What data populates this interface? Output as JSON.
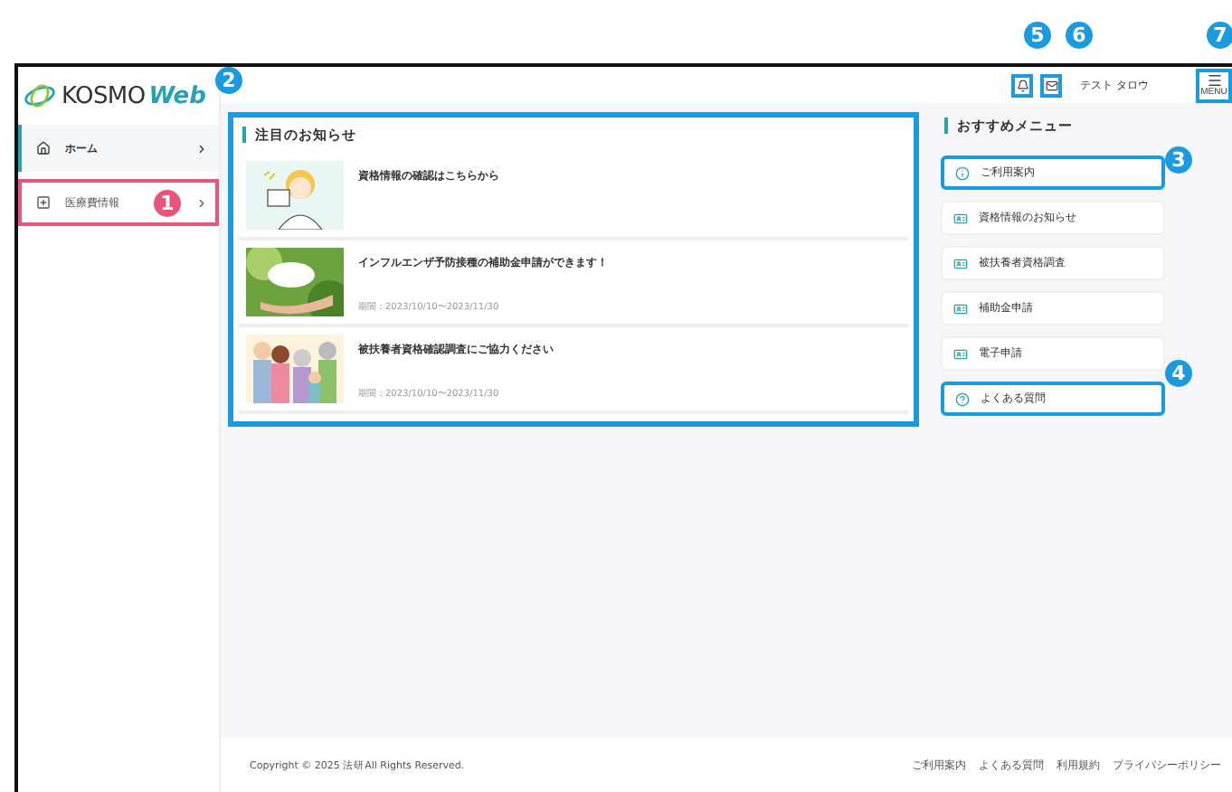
{
  "logo": {
    "brand": "KOSMO",
    "suffix": "Web"
  },
  "header": {
    "user_name": "テスト タロウ",
    "menu_label": "MENU",
    "bell_highlighted": true,
    "mail_highlighted": true,
    "menu_highlighted": true
  },
  "sidebar": {
    "items": [
      {
        "label": "ホーム",
        "kind": "home",
        "selected": true,
        "highlighted": false
      },
      {
        "label": "医療費情報",
        "kind": "plus",
        "selected": false,
        "highlighted": true
      }
    ]
  },
  "notices": {
    "title": "注目のお知らせ",
    "highlighted": true,
    "items": [
      {
        "title": "資格情報の確認はこちらから"
      },
      {
        "title": "インフルエンザ予防接種の補助金申請ができます！",
        "period": "期間：2023/10/10〜2023/11/30"
      },
      {
        "title": "被扶養者資格確認調査にご協力ください",
        "period": "期間：2023/10/10〜2023/11/30"
      }
    ]
  },
  "recommended": {
    "title": "おすすめメニュー",
    "items": [
      {
        "label": "ご利用案内",
        "kind": "info",
        "highlighted": true
      },
      {
        "label": "資格情報のお知らせ",
        "kind": "card",
        "highlighted": false
      },
      {
        "label": "被扶養者資格調査",
        "kind": "card",
        "highlighted": false
      },
      {
        "label": "補助金申請",
        "kind": "card",
        "highlighted": false
      },
      {
        "label": "電子申請",
        "kind": "card",
        "highlighted": false
      },
      {
        "label": "よくある質問",
        "kind": "help",
        "highlighted": true
      }
    ]
  },
  "footer": {
    "copyright": "Copyright © 2025 法研All Rights Reserved.",
    "links": [
      "ご利用案内",
      "よくある質問",
      "利用規約",
      "プライバシーポリシー"
    ]
  },
  "callouts": [
    {
      "label": "1",
      "color": "#e9547a"
    },
    {
      "label": "2",
      "color": "#1a9be0"
    },
    {
      "label": "3",
      "color": "#1a9be0"
    },
    {
      "label": "4",
      "color": "#1a9be0"
    },
    {
      "label": "5",
      "color": "#1a9be0"
    },
    {
      "label": "6",
      "color": "#1a9be0"
    },
    {
      "label": "7",
      "color": "#1a9be0"
    }
  ]
}
